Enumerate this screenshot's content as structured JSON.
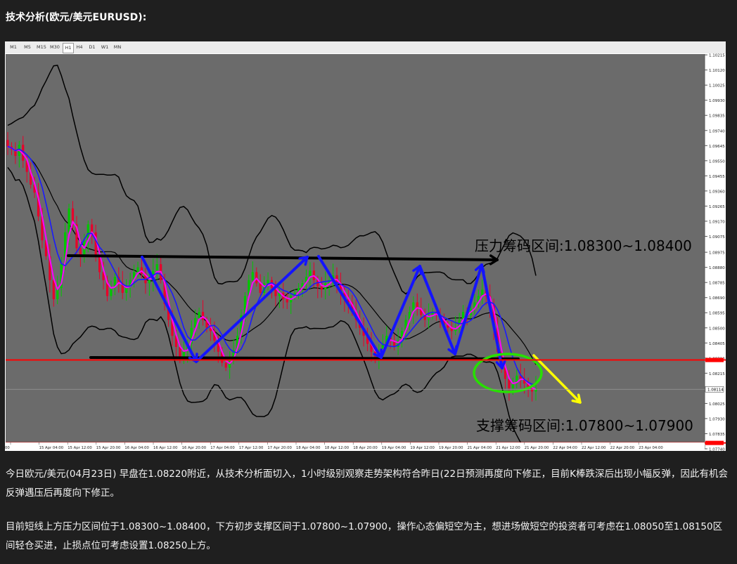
{
  "heading": "技术分析(欧元/美元EURUSD):",
  "timeframes": [
    "M1",
    "M5",
    "M15",
    "M30",
    "H1",
    "H4",
    "D1",
    "W1",
    "MN"
  ],
  "paragraphs": [
    "今日欧元/美元(04月23日) 早盘在1.08220附近，从技术分析面切入，1小时级别观察走势架构符合昨日(22日预测再度向下修正，目前K棒跌深后出现小幅反弹，因此有机会反弹遇压后再度向下修正。",
    "目前短线上方压力区间位于1.08300~1.08400，下方初步支撑区间于1.07800~1.07900，操作心态偏短空为主，想进场做短空的投资者可考虑在1.08050至1.08150区间轻仓买进，止损点位可考虑设置1.08250上方。"
  ],
  "colors": {
    "chart_bg": "#6b6b6b",
    "page_bg": "#1f1f1f",
    "bull": "#00c800",
    "bear": "#e8002a",
    "ma_fast": "#ff00ff",
    "ma_slow": "#1a1aff",
    "bands": "#000000",
    "arrows": "#1414ff",
    "resistance_line": "#000000",
    "red_lines": "#ff0000",
    "circle": "#27e000",
    "down_arrow": "#ffff00"
  },
  "chart_data": {
    "type": "candlestick",
    "symbol": "EURUSD",
    "timeframe": "H1",
    "ylim": [
      1.0774,
      1.1022
    ],
    "y_ticks": [
      "1.10215",
      "1.10120",
      "1.10025",
      "1.09930",
      "1.09835",
      "1.09740",
      "1.09645",
      "1.09550",
      "1.09455",
      "1.09360",
      "1.09265",
      "1.09170",
      "1.09075",
      "1.08975",
      "1.08880",
      "1.08785",
      "1.08690",
      "1.08595",
      "1.08500",
      "1.08405",
      "1.08310",
      "1.08215",
      "1.08025",
      "1.07930",
      "1.07835",
      "1.07740"
    ],
    "x_ticks": [
      "00",
      "15 Apr 04:00",
      "15 Apr 12:00",
      "15 Apr 20:00",
      "16 Apr 04:00",
      "16 Apr 12:00",
      "16 Apr 20:00",
      "17 Apr 04:00",
      "17 Apr 12:00",
      "17 Apr 20:00",
      "18 Apr 04:00",
      "18 Apr 12:00",
      "18 Apr 20:00",
      "19 Apr 04:00",
      "19 Apr 12:00",
      "19 Apr 20:00",
      "21 Apr 04:00",
      "21 Apr 12:00",
      "21 Apr 20:00",
      "22 Apr 04:00",
      "22 Apr 12:00",
      "22 Apr 20:00",
      "23 Apr 04:00"
    ],
    "current_price_label": "1.08114",
    "current_price": 1.08114,
    "red_line_levels": [
      1.08298,
      1.07777
    ],
    "resistance_label": "压力筹码区间:1.08300~1.08400",
    "support_label": "支撑筹码区间:1.07800~1.07900",
    "closes": [
      1.0964,
      1.0962,
      1.0958,
      1.0965,
      1.0955,
      1.0948,
      1.094,
      1.0935,
      1.092,
      1.0905,
      1.0895,
      1.088,
      1.0868,
      1.0875,
      1.089,
      1.091,
      1.0925,
      1.0915,
      1.09,
      1.0895,
      1.0905,
      1.0915,
      1.091,
      1.0895,
      1.0885,
      1.088,
      1.087,
      1.0875,
      1.0882,
      1.0878,
      1.0872,
      1.0876,
      1.088,
      1.0885,
      1.0888,
      1.0884,
      1.0878,
      1.088,
      1.0886,
      1.089,
      1.088,
      1.0865,
      1.0855,
      1.0845,
      1.0838,
      1.0832,
      1.0836,
      1.084,
      1.085,
      1.0856,
      1.086,
      1.0855,
      1.085,
      1.0848,
      1.0842,
      1.0835,
      1.0828,
      1.0825,
      1.083,
      1.0836,
      1.0845,
      1.0858,
      1.087,
      1.088,
      1.0885,
      1.0878,
      1.0872,
      1.0878,
      1.088,
      1.0875,
      1.087,
      1.0872,
      1.0868,
      1.0866,
      1.087,
      1.0872,
      1.0875,
      1.0878,
      1.0882,
      1.0886,
      1.088,
      1.0876,
      1.0874,
      1.0878,
      1.088,
      1.0883,
      1.0878,
      1.0872,
      1.0868,
      1.0866,
      1.086,
      1.0855,
      1.085,
      1.0845,
      1.084,
      1.0835,
      1.0832,
      1.0835,
      1.084,
      1.0845,
      1.0842,
      1.0838,
      1.0842,
      1.0848,
      1.0855,
      1.086,
      1.0866,
      1.0862,
      1.0858,
      1.0855,
      1.0858,
      1.086,
      1.0858,
      1.0855,
      1.0852,
      1.085,
      1.0848,
      1.085,
      1.0855,
      1.086,
      1.0858,
      1.0862,
      1.0866,
      1.087,
      1.0874,
      1.087,
      1.0864,
      1.085,
      1.0835,
      1.0825,
      1.0818,
      1.0812,
      1.0815,
      1.082,
      1.0818,
      1.0815,
      1.0812,
      1.081,
      1.0812
    ]
  }
}
